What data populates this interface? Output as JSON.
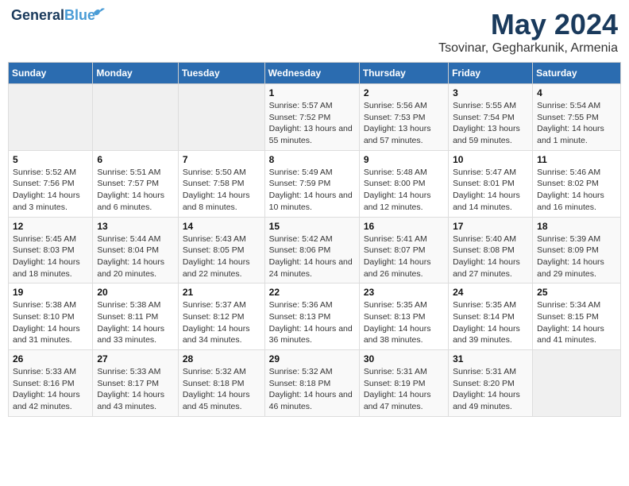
{
  "header": {
    "logo_line1": "General",
    "logo_line2": "Blue",
    "title": "May 2024",
    "subtitle": "Tsovinar, Gegharkunik, Armenia"
  },
  "weekdays": [
    "Sunday",
    "Monday",
    "Tuesday",
    "Wednesday",
    "Thursday",
    "Friday",
    "Saturday"
  ],
  "weeks": [
    [
      {
        "num": "",
        "sunrise": "",
        "sunset": "",
        "daylight": "",
        "empty": true
      },
      {
        "num": "",
        "sunrise": "",
        "sunset": "",
        "daylight": "",
        "empty": true
      },
      {
        "num": "",
        "sunrise": "",
        "sunset": "",
        "daylight": "",
        "empty": true
      },
      {
        "num": "1",
        "sunrise": "5:57 AM",
        "sunset": "7:52 PM",
        "daylight": "13 hours and 55 minutes."
      },
      {
        "num": "2",
        "sunrise": "5:56 AM",
        "sunset": "7:53 PM",
        "daylight": "13 hours and 57 minutes."
      },
      {
        "num": "3",
        "sunrise": "5:55 AM",
        "sunset": "7:54 PM",
        "daylight": "13 hours and 59 minutes."
      },
      {
        "num": "4",
        "sunrise": "5:54 AM",
        "sunset": "7:55 PM",
        "daylight": "14 hours and 1 minute."
      }
    ],
    [
      {
        "num": "5",
        "sunrise": "5:52 AM",
        "sunset": "7:56 PM",
        "daylight": "14 hours and 3 minutes."
      },
      {
        "num": "6",
        "sunrise": "5:51 AM",
        "sunset": "7:57 PM",
        "daylight": "14 hours and 6 minutes."
      },
      {
        "num": "7",
        "sunrise": "5:50 AM",
        "sunset": "7:58 PM",
        "daylight": "14 hours and 8 minutes."
      },
      {
        "num": "8",
        "sunrise": "5:49 AM",
        "sunset": "7:59 PM",
        "daylight": "14 hours and 10 minutes."
      },
      {
        "num": "9",
        "sunrise": "5:48 AM",
        "sunset": "8:00 PM",
        "daylight": "14 hours and 12 minutes."
      },
      {
        "num": "10",
        "sunrise": "5:47 AM",
        "sunset": "8:01 PM",
        "daylight": "14 hours and 14 minutes."
      },
      {
        "num": "11",
        "sunrise": "5:46 AM",
        "sunset": "8:02 PM",
        "daylight": "14 hours and 16 minutes."
      }
    ],
    [
      {
        "num": "12",
        "sunrise": "5:45 AM",
        "sunset": "8:03 PM",
        "daylight": "14 hours and 18 minutes."
      },
      {
        "num": "13",
        "sunrise": "5:44 AM",
        "sunset": "8:04 PM",
        "daylight": "14 hours and 20 minutes."
      },
      {
        "num": "14",
        "sunrise": "5:43 AM",
        "sunset": "8:05 PM",
        "daylight": "14 hours and 22 minutes."
      },
      {
        "num": "15",
        "sunrise": "5:42 AM",
        "sunset": "8:06 PM",
        "daylight": "14 hours and 24 minutes."
      },
      {
        "num": "16",
        "sunrise": "5:41 AM",
        "sunset": "8:07 PM",
        "daylight": "14 hours and 26 minutes."
      },
      {
        "num": "17",
        "sunrise": "5:40 AM",
        "sunset": "8:08 PM",
        "daylight": "14 hours and 27 minutes."
      },
      {
        "num": "18",
        "sunrise": "5:39 AM",
        "sunset": "8:09 PM",
        "daylight": "14 hours and 29 minutes."
      }
    ],
    [
      {
        "num": "19",
        "sunrise": "5:38 AM",
        "sunset": "8:10 PM",
        "daylight": "14 hours and 31 minutes."
      },
      {
        "num": "20",
        "sunrise": "5:38 AM",
        "sunset": "8:11 PM",
        "daylight": "14 hours and 33 minutes."
      },
      {
        "num": "21",
        "sunrise": "5:37 AM",
        "sunset": "8:12 PM",
        "daylight": "14 hours and 34 minutes."
      },
      {
        "num": "22",
        "sunrise": "5:36 AM",
        "sunset": "8:13 PM",
        "daylight": "14 hours and 36 minutes."
      },
      {
        "num": "23",
        "sunrise": "5:35 AM",
        "sunset": "8:13 PM",
        "daylight": "14 hours and 38 minutes."
      },
      {
        "num": "24",
        "sunrise": "5:35 AM",
        "sunset": "8:14 PM",
        "daylight": "14 hours and 39 minutes."
      },
      {
        "num": "25",
        "sunrise": "5:34 AM",
        "sunset": "8:15 PM",
        "daylight": "14 hours and 41 minutes."
      }
    ],
    [
      {
        "num": "26",
        "sunrise": "5:33 AM",
        "sunset": "8:16 PM",
        "daylight": "14 hours and 42 minutes."
      },
      {
        "num": "27",
        "sunrise": "5:33 AM",
        "sunset": "8:17 PM",
        "daylight": "14 hours and 43 minutes."
      },
      {
        "num": "28",
        "sunrise": "5:32 AM",
        "sunset": "8:18 PM",
        "daylight": "14 hours and 45 minutes."
      },
      {
        "num": "29",
        "sunrise": "5:32 AM",
        "sunset": "8:18 PM",
        "daylight": "14 hours and 46 minutes."
      },
      {
        "num": "30",
        "sunrise": "5:31 AM",
        "sunset": "8:19 PM",
        "daylight": "14 hours and 47 minutes."
      },
      {
        "num": "31",
        "sunrise": "5:31 AM",
        "sunset": "8:20 PM",
        "daylight": "14 hours and 49 minutes."
      },
      {
        "num": "",
        "sunrise": "",
        "sunset": "",
        "daylight": "",
        "empty": true
      }
    ]
  ],
  "labels": {
    "sunrise_prefix": "Sunrise: ",
    "sunset_prefix": "Sunset: ",
    "daylight_prefix": "Daylight: "
  }
}
